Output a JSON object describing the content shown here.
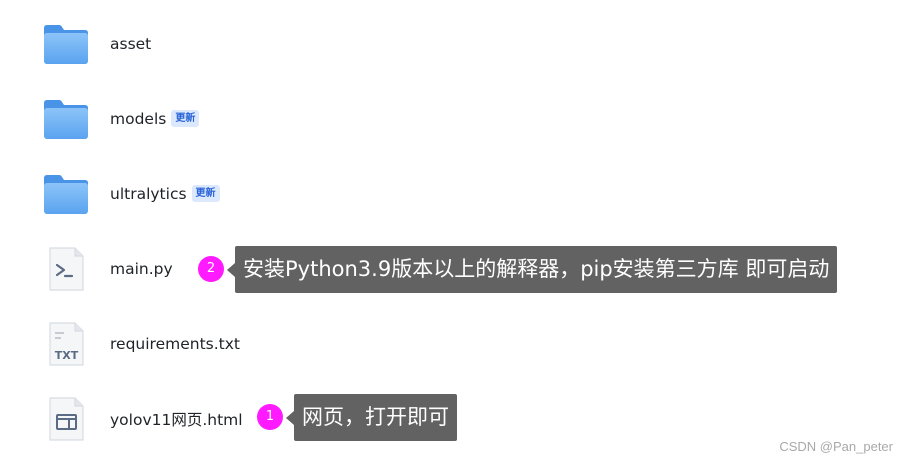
{
  "files": [
    {
      "name": "asset",
      "icon": "folder-icon",
      "badge": ""
    },
    {
      "name": "models",
      "icon": "folder-icon",
      "badge": "更新"
    },
    {
      "name": "ultralytics",
      "icon": "folder-icon",
      "badge": "更新"
    },
    {
      "name": "main.py",
      "icon": "python-script-icon",
      "badge": ""
    },
    {
      "name": "requirements.txt",
      "icon": "txt-file-icon",
      "badge": ""
    },
    {
      "name": "yolov11网页.html",
      "icon": "html-file-icon",
      "badge": ""
    }
  ],
  "annotations": [
    {
      "number": "2",
      "text": "安装Python3.9版本以上的解释器，pip安装第三方库 即可启动"
    },
    {
      "number": "1",
      "text": "网页，打开即可"
    }
  ],
  "watermark": "CSDN @Pan_peter",
  "colors": {
    "marker": "#ff1aff",
    "callout_bg": "#626262",
    "badge_bg": "#dce8fc",
    "badge_text": "#2b64d8",
    "folder": "#5aa3f0"
  }
}
